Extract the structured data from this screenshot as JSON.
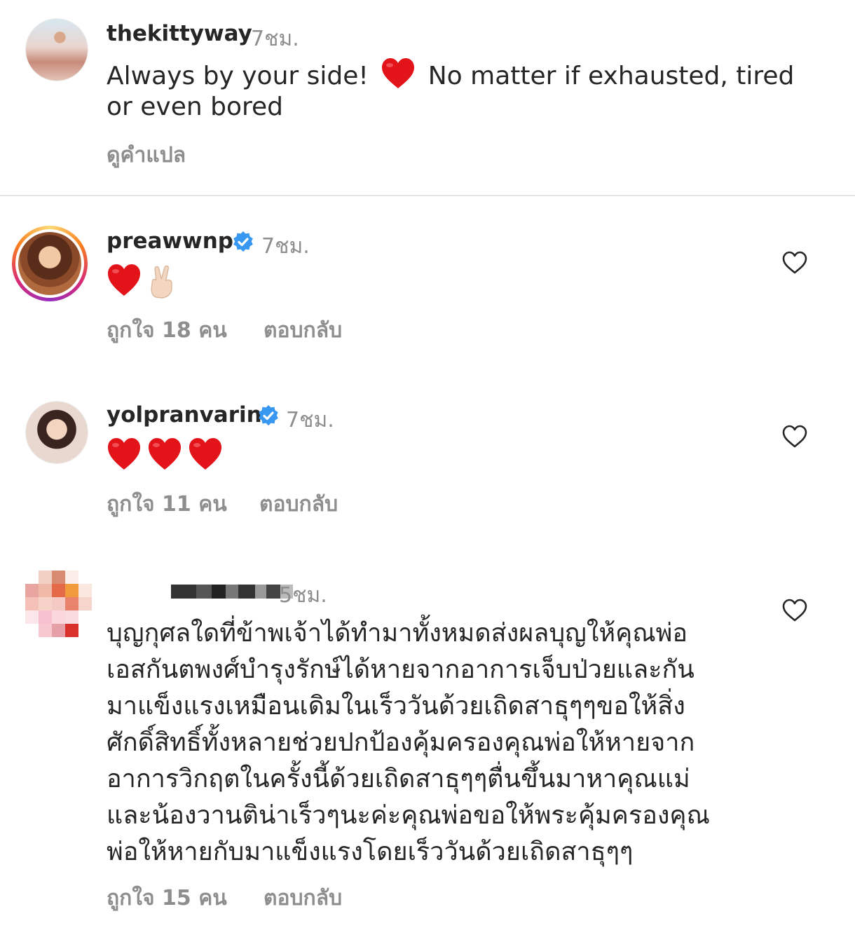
{
  "colors": {
    "text": "#262626",
    "muted": "#8e8e8e",
    "verified": "#3897f0",
    "heart": "#e3131a"
  },
  "comments": [
    {
      "username": "thekittyway",
      "time": "7ชม.",
      "text_before": "Always by your side!",
      "text_after": "No matter if exhausted, tired",
      "text_line2": "or even bored",
      "translate_label": "ดูคำแปล"
    },
    {
      "username": "preawwnp",
      "verified": true,
      "time": "7ชม.",
      "emojis": [
        "heart",
        "victory-hand"
      ],
      "likes_label": "ถูกใจ 18 คน",
      "reply_label": "ตอบกลับ"
    },
    {
      "username": "yolpranvarin",
      "verified": true,
      "time": "7ชม.",
      "emojis": [
        "heart",
        "heart",
        "heart"
      ],
      "likes_label": "ถูกใจ 11 คน",
      "reply_label": "ตอบกลับ"
    },
    {
      "username_redacted": true,
      "time": "5ชม.",
      "lines": [
        "บุญกุศลใดที่ข้าพเจ้าได้ทำมาทั้งหมดส่งผลบุญให้คุณพ่อ",
        "เอสกันตพงศ์บำรุงรักษ์ได้หายจากอาการเจ็บป่วยและกัน",
        "มาแข็งแรงเหมือนเดิมในเร็ววันด้วยเถิดสาธุๆๆขอให้สิ่ง",
        "ศักดิ์สิทธิ์ทั้งหลายช่วยปกป้องคุ้มครองคุณพ่อให้หายจาก",
        "อาการวิกฤตในครั้งนี้ด้วยเถิดสาธุๆๆตื่นขึ้นมาหาคุณแม่",
        "และน้องวานติน่าเร็วๆนะค่ะคุณพ่อขอให้พระคุ้มครองคุณ",
        "พ่อให้หายกับมาแข็งแรงโดยเร็ววันด้วยเถิดสาธุๆๆ"
      ],
      "likes_label": "ถูกใจ 15 คน",
      "reply_label": "ตอบกลับ"
    }
  ]
}
